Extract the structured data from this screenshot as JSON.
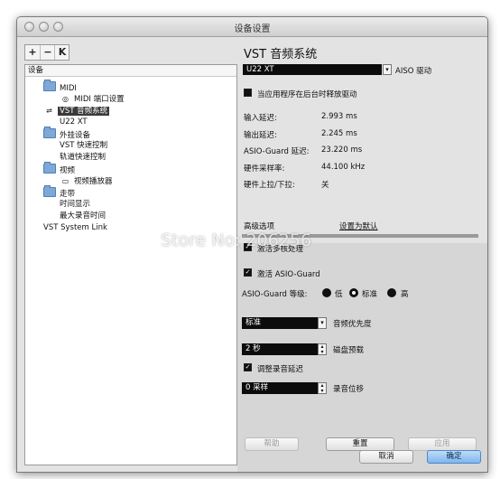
{
  "window": {
    "title": "设备设置"
  },
  "left_toolbar": {
    "add": "+",
    "remove": "−",
    "reset": "K"
  },
  "tree": {
    "header": "设备",
    "items": [
      {
        "label": "MIDI",
        "icon": "folder-icon"
      },
      {
        "label": "MIDI 端口设置",
        "icon": "midi-port-icon"
      },
      {
        "label": "VST 音频系统",
        "icon": "audio-system-icon",
        "selected": true
      },
      {
        "label": "U22 XT",
        "icon": ""
      },
      {
        "label": "外挂设备",
        "icon": "folder-icon"
      },
      {
        "label": "VST 快速控制",
        "icon": ""
      },
      {
        "label": "轨道快速控制",
        "icon": ""
      },
      {
        "label": "视频",
        "icon": "folder-icon"
      },
      {
        "label": "视频播放器",
        "icon": "video-player-icon"
      },
      {
        "label": "走带",
        "icon": "folder-icon"
      },
      {
        "label": "时间显示",
        "icon": ""
      },
      {
        "label": "最大录音时间",
        "icon": ""
      },
      {
        "label": "VST System Link",
        "icon": ""
      }
    ]
  },
  "panel": {
    "title": "VST 音频系统",
    "driver_value": "U22 XT",
    "driver_label": "AISO 驱动",
    "release_driver_label": "当应用程序在后台时释放驱动",
    "stats": [
      {
        "label": "输入延迟:",
        "value": "2.993 ms"
      },
      {
        "label": "输出延迟:",
        "value": "2.245 ms"
      },
      {
        "label": "ASIO-Guard 延迟:",
        "value": "23.220 ms"
      },
      {
        "label": "硬件采样率:",
        "value": "44.100 kHz"
      },
      {
        "label": "硬件上拉/下拉:",
        "value": "关"
      }
    ],
    "advanced_label": "高级选项",
    "set_default_label": "设置为默认",
    "multi_processing_label": "激活多核处理",
    "asio_guard_label": "激活 ASIO-Guard",
    "asio_guard_level_label": "ASIO-Guard 等级:",
    "levels": [
      "低",
      "标准",
      "高"
    ],
    "audio_priority_value": "标准",
    "audio_priority_label": "音频优先度",
    "disk_preload_value": "2 秒",
    "disk_preload_label": "磁盘预载",
    "adjust_record_latency_label": "调整录音延迟",
    "record_shift_value": "0 采样",
    "record_shift_label": "录音位移",
    "help_button": "帮助",
    "reset_button": "重置",
    "apply_button": "应用"
  },
  "footer": {
    "cancel": "取消",
    "ok": "确定"
  },
  "watermark": "Store No: 206256"
}
